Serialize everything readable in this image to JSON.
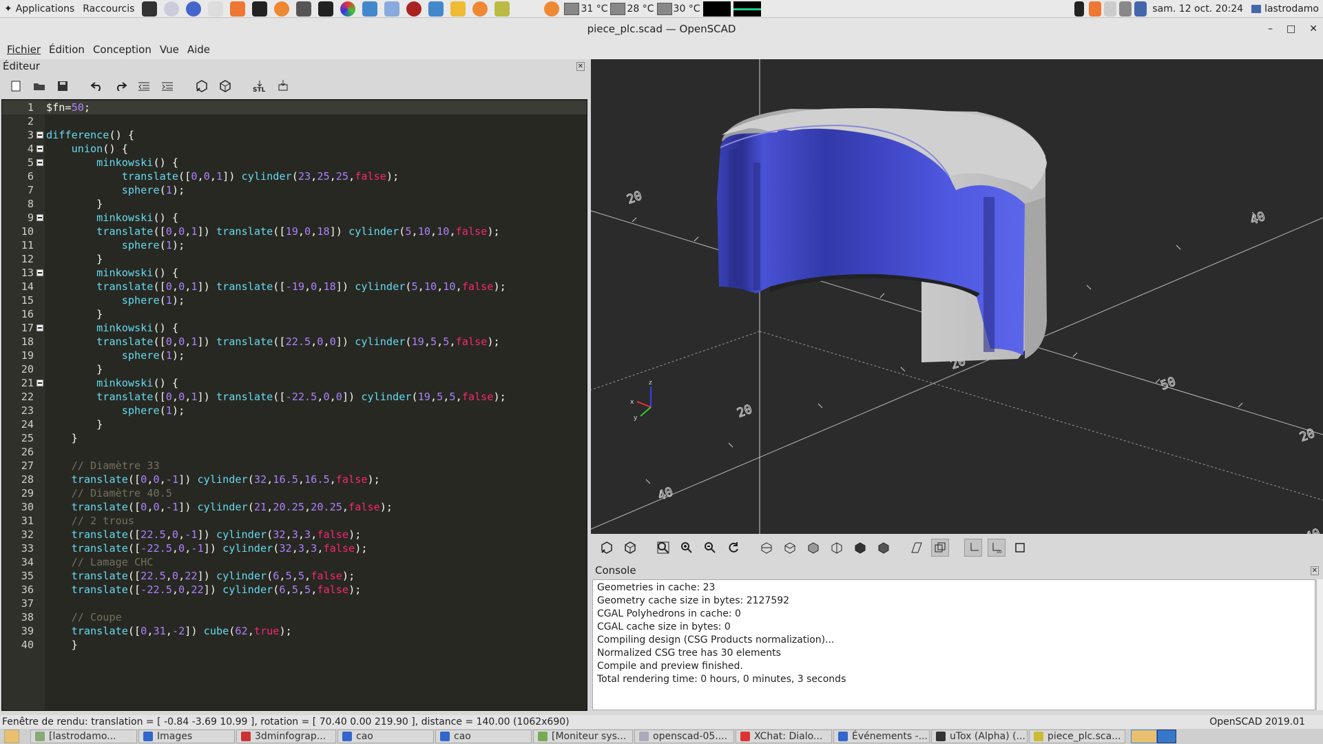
{
  "top_panel": {
    "applications": "Applications",
    "shortcuts": "Raccourcis",
    "temps": [
      "31 °C",
      "28 °C",
      "30 °C"
    ],
    "datetime": "sam. 12 oct.  20:24",
    "user": "lastrodamo"
  },
  "window": {
    "title": "piece_plc.scad — OpenSCAD",
    "minimize": "–",
    "maximize": "□",
    "close": "✕"
  },
  "menu": [
    "Fichier",
    "Édition",
    "Conception",
    "Vue",
    "Aide"
  ],
  "editor": {
    "title": "Éditeur",
    "close": "✕",
    "lines": [
      "$fn=50;",
      "",
      "difference() {",
      "    union() {",
      "        minkowski() {",
      "            translate([0,0,1]) cylinder(23,25,25,false);",
      "            sphere(1);",
      "        }",
      "        minkowski() {",
      "        translate([0,0,1]) translate([19,0,18]) cylinder(5,10,10,false);",
      "            sphere(1);",
      "        }",
      "        minkowski() {",
      "        translate([0,0,1]) translate([-19,0,18]) cylinder(5,10,10,false);",
      "            sphere(1);",
      "        }",
      "        minkowski() {",
      "        translate([0,0,1]) translate([22.5,0,0]) cylinder(19,5,5,false);",
      "            sphere(1);",
      "        }",
      "        minkowski() {",
      "        translate([0,0,1]) translate([-22.5,0,0]) cylinder(19,5,5,false);",
      "            sphere(1);",
      "        }",
      "    }",
      "",
      "    // Diamètre 33",
      "    translate([0,0,-1]) cylinder(32,16.5,16.5,false);",
      "    // Diamètre 40.5",
      "    translate([0,0,-1]) cylinder(21,20.25,20.25,false);",
      "    // 2 trous",
      "    translate([22.5,0,-1]) cylinder(32,3,3,false);",
      "    translate([-22.5,0,-1]) cylinder(32,3,3,false);",
      "    // Lamage CHC",
      "    translate([22.5,0,22]) cylinder(6,5,5,false);",
      "    translate([-22.5,0,22]) cylinder(6,5,5,false);",
      "",
      "    // Coupe",
      "    translate([0,31,-2]) cube(62,true);",
      "    }"
    ]
  },
  "viewport": {
    "axis_labels": [
      "50",
      "20",
      "20",
      "20",
      "40",
      "40",
      "20",
      "40",
      "20",
      "50"
    ],
    "gizmo": {
      "z": "z",
      "x": "x",
      "y": "y"
    }
  },
  "console": {
    "title": "Console",
    "close": "✕",
    "lines": [
      "Geometries in cache: 23",
      "Geometry cache size in bytes: 2127592",
      "CGAL Polyhedrons in cache: 0",
      "CGAL cache size in bytes: 0",
      "Compiling design (CSG Products normalization)...",
      "Normalized CSG tree has 30 elements",
      "Compile and preview finished.",
      "Total rendering time: 0 hours, 0 minutes, 3 seconds"
    ]
  },
  "status": {
    "left": "Fenêtre de rendu: translation = [ -0.84 -3.69 10.99 ], rotation = [ 70.40 0.00 219.90 ], distance = 140.00 (1062x690)",
    "right": "OpenSCAD 2019.01"
  },
  "taskbar": [
    {
      "label": "[lastrodamo...",
      "color": "#8a7"
    },
    {
      "label": "Images",
      "color": "#36c"
    },
    {
      "label": "3dminfograp...",
      "color": "#c33"
    },
    {
      "label": "cao",
      "color": "#36c"
    },
    {
      "label": "cao",
      "color": "#36c"
    },
    {
      "label": "[Moniteur sys...",
      "color": "#7a5"
    },
    {
      "label": "openscad-05....",
      "color": "#aab"
    },
    {
      "label": "XChat: Dialo...",
      "color": "#d33"
    },
    {
      "label": "Événements -...",
      "color": "#36c"
    },
    {
      "label": "uTox (Alpha) (...",
      "color": "#333"
    },
    {
      "label": "piece_plc.sca...",
      "color": "#cb3"
    }
  ]
}
